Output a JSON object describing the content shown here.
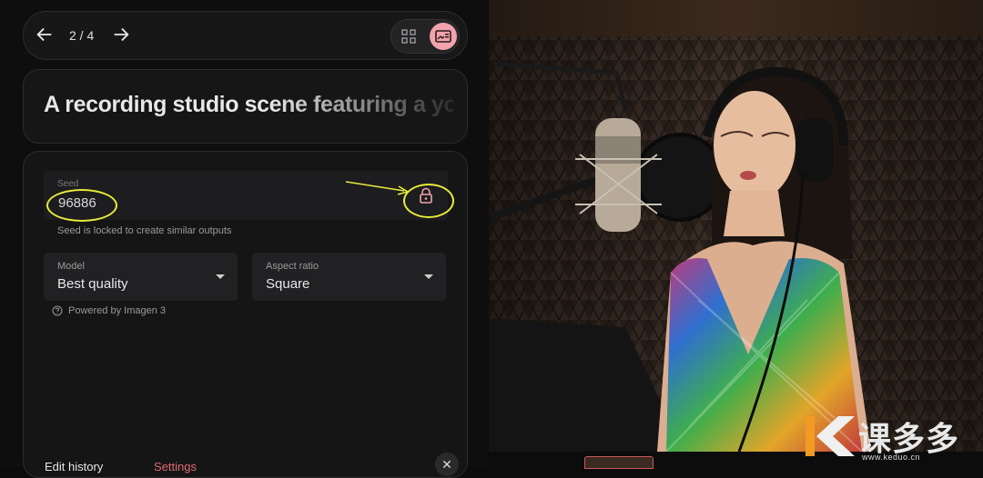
{
  "pager": {
    "text": "2 / 4"
  },
  "prompt": {
    "text": "A recording studio scene featuring a young woman singing"
  },
  "seed": {
    "label": "Seed",
    "value": "96886",
    "hint": "Seed is locked to create similar outputs"
  },
  "model": {
    "label": "Model",
    "value": "Best quality"
  },
  "aspect": {
    "label": "Aspect ratio",
    "value": "Square"
  },
  "powered": {
    "text": "Powered by Imagen 3"
  },
  "tabs": {
    "edit": "Edit history",
    "settings": "Settings"
  },
  "watermark": {
    "brand": "课多多",
    "url": "www.keduo.cn"
  },
  "colors": {
    "accent": "#f1a3ad",
    "annotation": "#e9ec3a",
    "tab_active": "#e06a72"
  }
}
